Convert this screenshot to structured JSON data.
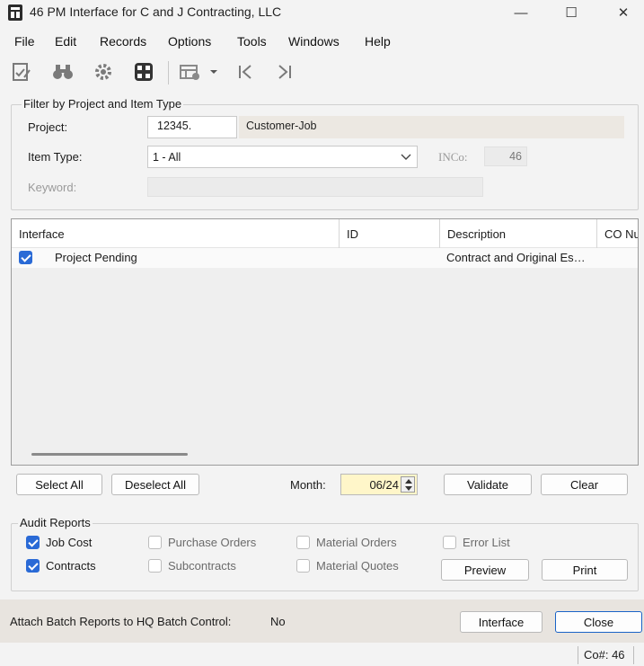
{
  "window": {
    "title": "46 PM Interface for C and J Contracting, LLC",
    "minimize_glyph": "—",
    "maximize_glyph": "☐",
    "close_glyph": "✕"
  },
  "menu": {
    "items": [
      "File",
      "Edit",
      "Records",
      "Options",
      "Tools",
      "Windows",
      "Help"
    ]
  },
  "toolbar": {
    "icons": [
      "checklist-edit-icon",
      "binoculars-icon",
      "gear-icon",
      "calculator-icon",
      "form-settings-icon",
      "dropdown-arrow-icon",
      "first-record-icon",
      "last-record-icon"
    ]
  },
  "filter": {
    "group_label": "Filter by Project and Item Type",
    "project_label": "Project:",
    "project_value": "12345.",
    "project_description": "Customer-Job",
    "item_type_label": "Item Type:",
    "item_type_value": "1 - All",
    "inco_label": "INCo:",
    "inco_value": "46",
    "keyword_label": "Keyword:"
  },
  "grid": {
    "columns": [
      "Interface",
      "ID",
      "Description",
      "CO Nu"
    ],
    "rows": [
      {
        "checked": true,
        "interface": "Project Pending",
        "id": "",
        "description": "Contract and Original Es…"
      }
    ]
  },
  "actions": {
    "select_all": "Select All",
    "deselect_all": "Deselect All",
    "month_label": "Month:",
    "month_value": "06/24",
    "validate": "Validate",
    "clear": "Clear"
  },
  "audit": {
    "group_label": "Audit Reports",
    "job_cost": "Job Cost",
    "contracts": "Contracts",
    "purchase_orders": "Purchase Orders",
    "subcontracts": "Subcontracts",
    "material_orders": "Material Orders",
    "material_quotes": "Material Quotes",
    "error_list": "Error List",
    "preview": "Preview",
    "print": "Print"
  },
  "footer": {
    "attach_label": "Attach Batch Reports to HQ Batch Control:",
    "attach_value": "No",
    "interface_button": "Interface",
    "close_button": "Close"
  },
  "status": {
    "company": "Co#: 46"
  },
  "colors": {
    "accent": "#2a6ad6",
    "month_bg": "#fff6c9",
    "footer_bg": "#e8e4df"
  }
}
